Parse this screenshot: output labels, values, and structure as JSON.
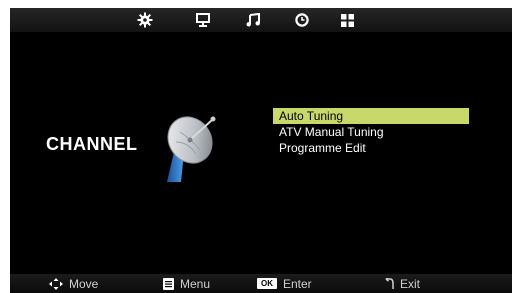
{
  "topbar": {
    "icons": [
      "gear-icon",
      "monitor-icon",
      "music-note-icon",
      "clock-icon",
      "grid-icon"
    ],
    "selected_index": 0
  },
  "section": {
    "title": "CHANNEL",
    "icon": "satellite-dish-icon"
  },
  "menu": {
    "items": [
      {
        "label": "Auto Tuning",
        "selected": true
      },
      {
        "label": "ATV Manual Tuning",
        "selected": false
      },
      {
        "label": "Programme Edit",
        "selected": false
      }
    ],
    "highlight_color": "#c8d86a"
  },
  "footer": {
    "move_label": "Move",
    "menu_label": "Menu",
    "ok_key": "OK",
    "enter_label": "Enter",
    "exit_label": "Exit"
  }
}
